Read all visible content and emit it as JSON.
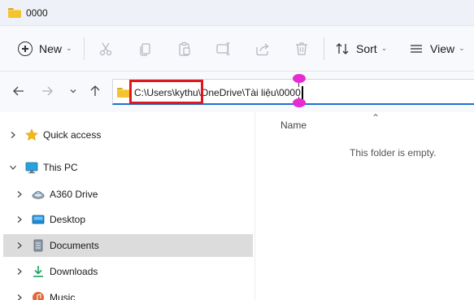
{
  "window": {
    "title": "0000"
  },
  "toolbar": {
    "new_label": "New",
    "sort_label": "Sort",
    "view_label": "View",
    "icons": [
      "cut-icon",
      "copy-icon",
      "paste-icon",
      "rename-icon",
      "share-icon",
      "delete-icon"
    ]
  },
  "address": {
    "path": "C:\\Users\\kythu\\OneDrive\\Tài liệu\\0000"
  },
  "sidebar": {
    "items": [
      {
        "label": "Quick access",
        "icon": "star-icon",
        "expanded": false
      },
      {
        "label": "This PC",
        "icon": "monitor-icon",
        "expanded": true
      },
      {
        "label": "A360 Drive",
        "icon": "cloud-drive-icon",
        "expanded": false
      },
      {
        "label": "Desktop",
        "icon": "desktop-icon",
        "expanded": false
      },
      {
        "label": "Documents",
        "icon": "documents-icon",
        "expanded": false,
        "selected": true
      },
      {
        "label": "Downloads",
        "icon": "download-icon",
        "expanded": false
      },
      {
        "label": "Music",
        "icon": "music-icon",
        "expanded": false
      }
    ]
  },
  "content": {
    "column_name": "Name",
    "empty_message": "This folder is empty."
  },
  "colors": {
    "accent": "#1f6fd0",
    "highlight_border": "#e0181e",
    "handle": "#e62bd3",
    "selected_bg": "#dcdcdc"
  }
}
